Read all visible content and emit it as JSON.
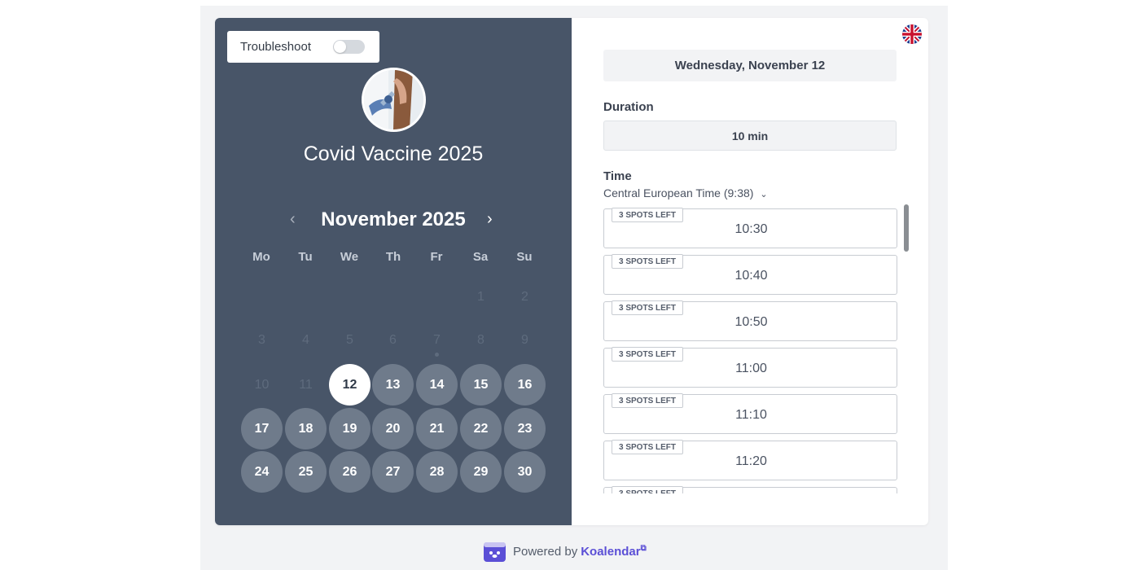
{
  "troubleshoot": {
    "label": "Troubleshoot",
    "enabled": false
  },
  "event": {
    "title": "Covid Vaccine 2025"
  },
  "calendar": {
    "month_label": "November 2025",
    "weekdays": [
      "Mo",
      "Tu",
      "We",
      "Th",
      "Fr",
      "Sa",
      "Su"
    ],
    "disabled_days": [
      "1",
      "2",
      "3",
      "4",
      "5",
      "6",
      "7",
      "8",
      "9",
      "10",
      "11"
    ],
    "available_days": [
      "13",
      "14",
      "15",
      "16",
      "17",
      "18",
      "19",
      "20",
      "21",
      "22",
      "23",
      "24",
      "25",
      "26",
      "27",
      "28",
      "29",
      "30"
    ],
    "selected_day": "12"
  },
  "booking": {
    "selected_date": "Wednesday, November 12",
    "duration_label": "Duration",
    "duration_value": "10 min",
    "time_label": "Time",
    "timezone": "Central European Time (9:38)",
    "slots": [
      {
        "badge": "3 SPOTS LEFT",
        "time": "10:30"
      },
      {
        "badge": "3 SPOTS LEFT",
        "time": "10:40"
      },
      {
        "badge": "3 SPOTS LEFT",
        "time": "10:50"
      },
      {
        "badge": "3 SPOTS LEFT",
        "time": "11:00"
      },
      {
        "badge": "3 SPOTS LEFT",
        "time": "11:10"
      },
      {
        "badge": "3 SPOTS LEFT",
        "time": "11:20"
      },
      {
        "badge": "3 SPOTS LEFT",
        "time": ""
      }
    ]
  },
  "footer": {
    "powered_text": "Powered by",
    "brand": "Koalendar"
  },
  "colors": {
    "panel": "#485568",
    "day_available": "#6f7b8b",
    "brand": "#5b4fd6"
  },
  "icons": {
    "language": "uk-flag-icon",
    "prev": "chevron-left-icon",
    "next": "chevron-right-icon",
    "timezone": "chevron-down-icon",
    "brand": "koalendar-logo-icon",
    "external": "external-link-icon"
  }
}
